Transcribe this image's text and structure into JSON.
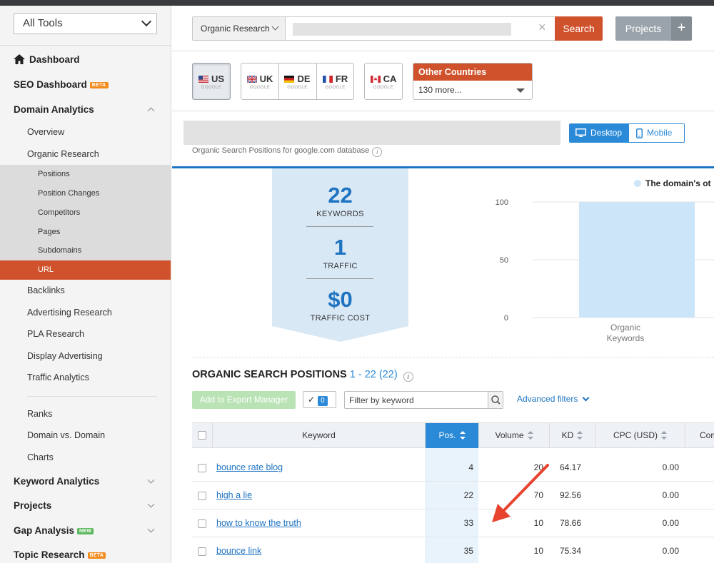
{
  "tools_select": "All Tools",
  "sidebar": {
    "dashboard": "Dashboard",
    "seo_dashboard": "SEO Dashboard",
    "seo_badge": "BETA",
    "domain_analytics": "Domain Analytics",
    "overview": "Overview",
    "organic_research": "Organic Research",
    "sub": [
      "Positions",
      "Position Changes",
      "Competitors",
      "Pages",
      "Subdomains",
      "URL"
    ],
    "backlinks": "Backlinks",
    "advertising_research": "Advertising Research",
    "pla_research": "PLA Research",
    "display_advertising": "Display Advertising",
    "traffic_analytics": "Traffic Analytics",
    "ranks": "Ranks",
    "domain_vs_domain": "Domain vs. Domain",
    "charts": "Charts",
    "keyword_analytics": "Keyword Analytics",
    "projects": "Projects",
    "gap_analysis": "Gap Analysis",
    "gap_badge": "NEW",
    "topic_research": "Topic Research",
    "topic_badge": "BETA"
  },
  "search": {
    "db_select": "Organic Research",
    "clear": "×",
    "button": "Search",
    "projects": "Projects",
    "projects_plus": "+"
  },
  "countries": {
    "us": "US",
    "uk": "UK",
    "de": "DE",
    "fr": "FR",
    "ca": "CA",
    "engine": "GOOGLE",
    "other_title": "Other Countries",
    "other_more": "130 more..."
  },
  "report": {
    "subtitle": "Organic Search Positions for google.com database",
    "info": "i",
    "desktop": "Desktop",
    "mobile": "Mobile"
  },
  "summary": {
    "keywords": "22",
    "keywords_label": "KEYWORDS",
    "traffic": "1",
    "traffic_label": "TRAFFIC",
    "traffic_cost": "$0",
    "traffic_cost_label": "TRAFFIC COST"
  },
  "chart_data": {
    "type": "bar",
    "legend": "The domain's ot",
    "categories": [
      "Organic Keywords"
    ],
    "category_lines": [
      "Organic",
      "Keywords"
    ],
    "values": [
      100
    ],
    "yticks": [
      "100",
      "50",
      "0"
    ],
    "ylim": [
      0,
      100
    ],
    "color": "#cde5f8"
  },
  "positions": {
    "title": "ORGANIC SEARCH POSITIONS",
    "range": "1 - 22 (22)",
    "export_btn": "Add to Export Manager",
    "check": "✓",
    "selected_count": "0",
    "filter_placeholder": "Filter by keyword",
    "advanced_filters": "Advanced filters",
    "columns": [
      "Keyword",
      "Pos.",
      "Volume",
      "KD",
      "CPC (USD)",
      "Com"
    ],
    "rows": [
      {
        "keyword": "bounce rate blog",
        "pos": "4",
        "volume": "20",
        "kd": "64.17",
        "cpc": "0.00"
      },
      {
        "keyword": "high a lie",
        "pos": "22",
        "volume": "70",
        "kd": "92.56",
        "cpc": "0.00"
      },
      {
        "keyword": "how to know the truth",
        "pos": "33",
        "volume": "10",
        "kd": "78.66",
        "cpc": "0.00"
      },
      {
        "keyword": "bounce link",
        "pos": "35",
        "volume": "10",
        "kd": "75.34",
        "cpc": "0.00"
      }
    ]
  },
  "colors": {
    "accent": "#d0522c",
    "blue": "#1f74c2",
    "pos_header": "#2a8ad8",
    "annotation_arrow": "#e8432e"
  }
}
